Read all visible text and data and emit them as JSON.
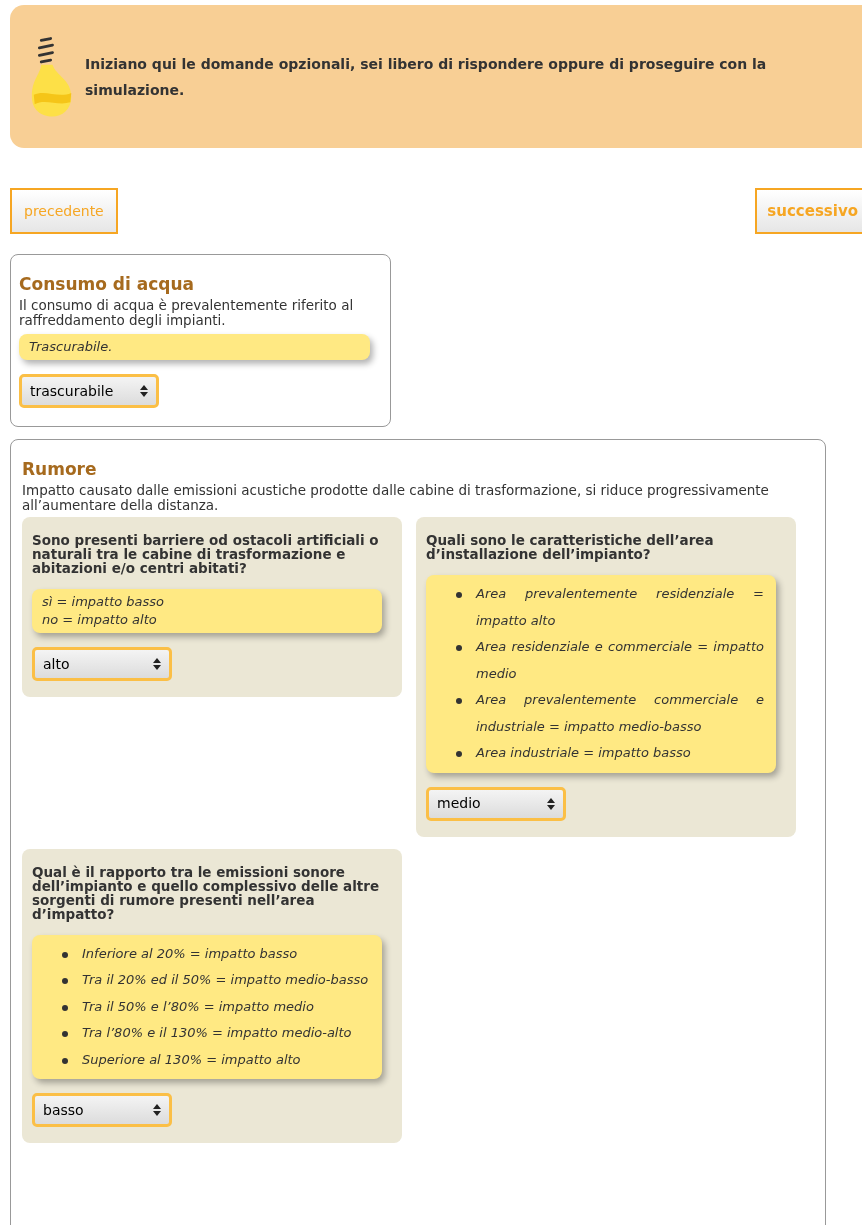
{
  "notice": {
    "text": "Iniziano qui le domande opzionali, sei libero di rispondere oppure di proseguire con la simulazione."
  },
  "nav": [
    {
      "kind": "prev",
      "label": "precedente"
    },
    {
      "kind": "next",
      "label": "successivo"
    }
  ],
  "sections": [
    {
      "kind": "single",
      "title": "Consumo di acqua",
      "description": "Il consumo di acqua è prevalentemente riferito al raffreddamento degli impianti.",
      "hint": {
        "kind": "lines",
        "lines": [
          "Trascurabile."
        ]
      },
      "select": "trascurabile"
    },
    {
      "kind": "questions",
      "title": "Rumore",
      "description": "Impatto causato dalle emissioni acustiche prodotte dalle cabine di trasformazione, si riduce progressivamente all’aumentare della distanza.",
      "questions": [
        {
          "question": "Sono presenti barriere od ostacoli artificiali o naturali tra le cabine di trasformazione e abitazioni e/o centri abitati?",
          "hint": {
            "kind": "lines",
            "lines": [
              "sì = impatto basso",
              "no = impatto alto"
            ]
          },
          "select": "alto"
        },
        {
          "question": "Quali sono le caratteristiche dell’area d’installazione dell’impianto?",
          "hint": {
            "kind": "bullets",
            "lines": [
              "Area prevalentemente residenziale = impatto alto",
              "Area residenziale e commerciale = impatto medio",
              "Area prevalentemente commerciale e industriale = impatto medio-basso",
              "Area industriale = impatto basso"
            ]
          },
          "select": "medio"
        },
        {
          "question": "Qual è il rapporto tra le emissioni sonore dell’impianto e quello complessivo delle altre sorgenti di rumore presenti nell’area d’impatto?",
          "hint": {
            "kind": "bullets",
            "lines": [
              "Inferiore al 20% = impatto basso",
              "Tra il 20% ed il 50% = impatto medio-basso",
              "Tra il 50% e l’80% = impatto medio",
              "Tra l’80% e il 130% = impatto medio-alto",
              "Superiore al 130% = impatto alto"
            ]
          },
          "select": "basso"
        }
      ]
    }
  ]
}
